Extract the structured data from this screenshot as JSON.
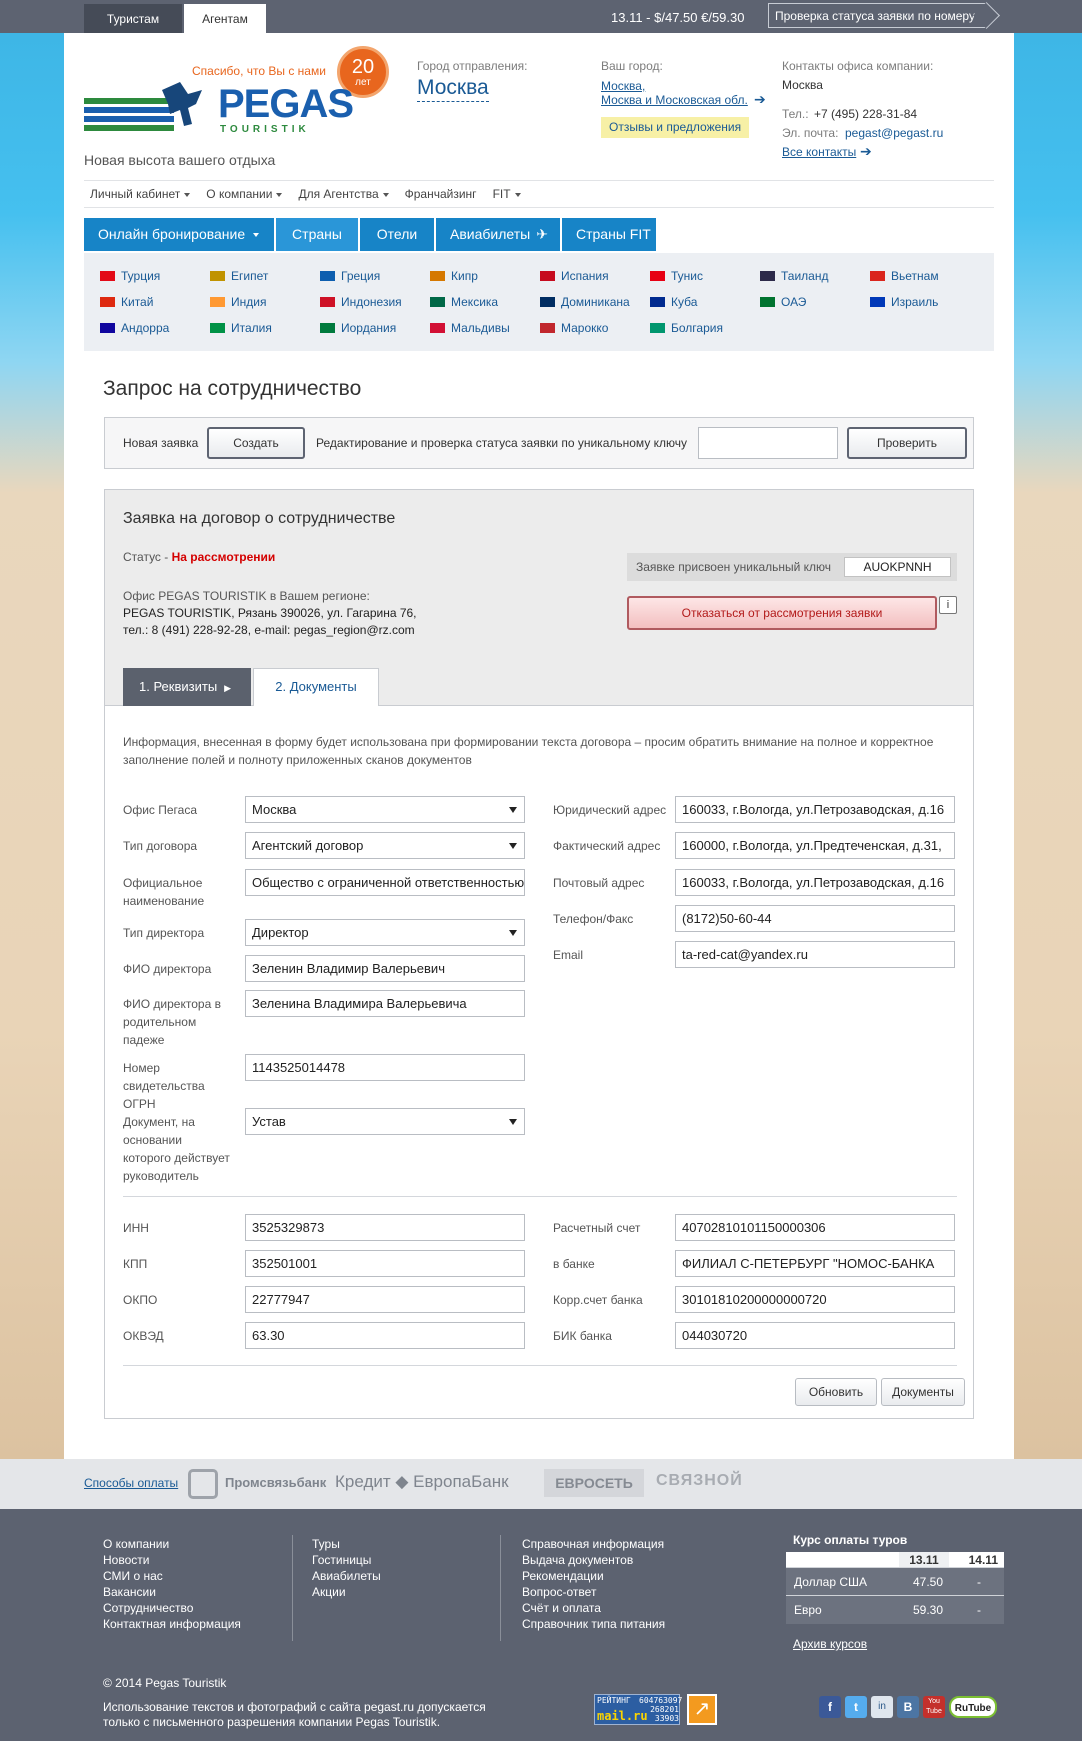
{
  "topbar": {
    "tab_tourists": "Туристам",
    "tab_agents": "Агентам",
    "rates": "13.11 - $/47.50 €/59.30",
    "status_check": "Проверка статуса заявки по номеру"
  },
  "header": {
    "thanks": "Спасибо, что Вы с нами",
    "years_num": "20",
    "years_word": "лет",
    "logo_text": "PEGAS",
    "logo_sub": "TOURISTIK",
    "slogan": "Новая высота вашего отдыха",
    "departure_label": "Город отправления:",
    "departure_city": "Москва",
    "your_city_label": "Ваш город:",
    "your_city_1": "Москва,",
    "your_city_2": "Москва и Московская обл.",
    "feedback": "Отзывы и предложения",
    "contacts_label": "Контакты офиса компании:",
    "contacts_city": "Москва",
    "phone_label": "Тел.:",
    "phone": "+7 (495) 228-31-84",
    "email_label": "Эл. почта:",
    "email": "pegast@pegast.ru",
    "all_contacts": "Все контакты"
  },
  "nav": {
    "items": [
      "Личный кабинет",
      "О компании",
      "Для Агентства",
      "Франчайзинг",
      "FIT"
    ],
    "blue": [
      "Онлайн бронирование",
      "Страны",
      "Отели",
      "Авиабилеты",
      "Страны FIT"
    ]
  },
  "countries": [
    [
      "Турция",
      "Египет",
      "Греция",
      "Кипр",
      "Испания",
      "Тунис",
      "Таиланд",
      "Вьетнам"
    ],
    [
      "Китай",
      "Индия",
      "Индонезия",
      "Мексика",
      "Доминикана",
      "Куба",
      "ОАЭ",
      "Израиль"
    ],
    [
      "Андорра",
      "Италия",
      "Иордания",
      "Мальдивы",
      "Марокко",
      "Болгария"
    ]
  ],
  "page": {
    "title": "Запрос на сотрудничество",
    "new_request": "Новая заявка",
    "create_btn": "Создать",
    "edit_label": "Редактирование и проверка статуса заявки по уникальному ключу",
    "key_input_value": "",
    "check_btn": "Проверить"
  },
  "request": {
    "title": "Заявка на договор о сотрудничестве",
    "status_label": "Статус -",
    "status_value": "На рассмотрении",
    "key_label": "Заявке присвоен уникальный ключ",
    "key_value": "AUOKPNNH",
    "cancel_btn": "Отказаться от рассмотрения заявки",
    "info_btn": "i",
    "office_line1": "Офис PEGAS TOURISTIK в Вашем регионе:",
    "office_line2": "PEGAS TOURISTIK, Рязань 390026, ул. Гагарина 76,",
    "office_line3": "тел.: 8 (491) 228-92-28, e-mail: pegas_region@rz.com",
    "tab1": "1. Реквизиты",
    "tab2": "2. Документы",
    "notice": "Информация, внесенная в форму будет использована при формировании текста договора – просим обратить внимание на полное и корректное заполнение полей и полноту приложенных сканов документов"
  },
  "form_left": [
    {
      "label": "Офис Пегаса",
      "value": "Москва"
    },
    {
      "label": "Тип договора",
      "value": "Агентский договор"
    },
    {
      "label": "Официальное наименование",
      "value": "Общество с ограниченной ответственностью"
    },
    {
      "label": "Тип директора",
      "value": "Директор"
    },
    {
      "label": "ФИО директора",
      "value": "Зеленин Владимир Валерьевич"
    },
    {
      "label": "ФИО директора в родительном падеже",
      "value": "Зеленина Владимира Валерьевича"
    },
    {
      "label": "Номер свидетельства ОГРН",
      "value": "1143525014478"
    },
    {
      "label": "Документ, на основании которого действует руководитель",
      "value": "Устав"
    }
  ],
  "form_right": [
    {
      "label": "Юридический адрес",
      "value": "160033, г.Вологда, ул.Петрозаводская, д.16"
    },
    {
      "label": "Фактический адрес",
      "value": "160000, г.Вологда, ул.Предтеченская, д.31,"
    },
    {
      "label": "Почтовый адрес",
      "value": "160033, г.Вологда, ул.Петрозаводская, д.16"
    },
    {
      "label": "Телефон/Факс",
      "value": "(8172)50-60-44"
    },
    {
      "label": "Email",
      "value": "ta-red-cat@yandex.ru"
    }
  ],
  "bank_left": [
    {
      "label": "ИНН",
      "value": "3525329873"
    },
    {
      "label": "КПП",
      "value": "352501001"
    },
    {
      "label": "ОКПО",
      "value": "22777947"
    },
    {
      "label": "ОКВЭД",
      "value": "63.30"
    }
  ],
  "bank_right": [
    {
      "label": "Расчетный счет",
      "value": "40702810101150000306"
    },
    {
      "label": "в банке",
      "value": "ФИЛИАЛ С-ПЕТЕРБУРГ \"НОМОС-БАНКА"
    },
    {
      "label": "Корр.счет банка",
      "value": "30101810200000000720"
    },
    {
      "label": "БИК банка",
      "value": "044030720"
    }
  ],
  "actions": {
    "update": "Обновить",
    "documents": "Документы"
  },
  "payments": {
    "label": "Способы оплаты",
    "logos": [
      "Промсвязьбанк",
      "Кредит",
      "ЕвропаБанк",
      "ЕВРОСЕТЬ",
      "СВЯЗНОЙ"
    ]
  },
  "footer": {
    "col1": [
      "О компании",
      "Новости",
      "СМИ о нас",
      "Вакансии",
      "Сотрудничество",
      "Контактная информация"
    ],
    "col2": [
      "Туры",
      "Гостиницы",
      "Авиабилеты",
      "Акции"
    ],
    "col3": [
      "Справочная информация",
      "Выдача документов",
      "Рекомендации",
      "Вопрос-ответ",
      "Счёт и оплата",
      "Справочник типа питания"
    ],
    "rates_title": "Курс оплаты туров",
    "rates_dates": [
      "13.11",
      "14.11"
    ],
    "rates_rows": [
      [
        "Доллар США",
        "47.50",
        "-"
      ],
      [
        "Евро",
        "59.30",
        "-"
      ]
    ],
    "archive": "Архив курсов",
    "copyright": "© 2014 Pegas Touristik",
    "legal1": "Использование текстов и фотографий с сайта pegast.ru допускается",
    "legal2": "только с письменного разрешения компании Pegas Touristik.",
    "counter_label": "РЕЙТИНГ",
    "counter_brand": "mail.ru",
    "counter_nums": [
      "604763097",
      "268201",
      "33903"
    ],
    "social": [
      "f",
      "t",
      "in",
      "B",
      "You Tube",
      "RuTube"
    ]
  },
  "colors": {
    "accent": "#1784c7",
    "status_red": "#d40000",
    "panel_bg": "#ececec",
    "footer_bg": "#5c6270"
  }
}
